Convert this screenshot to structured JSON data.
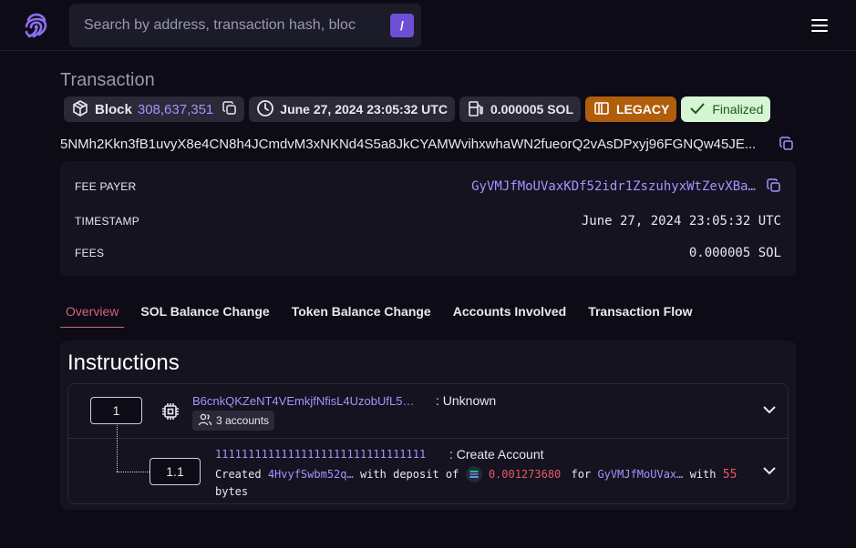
{
  "header": {
    "search_placeholder": "Search by address, transaction hash, bloc",
    "search_shortcut": "/",
    "logo_icon": "solana-fingerprint-logo",
    "menu_icon": "hamburger-menu-icon"
  },
  "page": {
    "title": "Transaction",
    "signature": "5NMh2Kkn3fB1uvyX8e4CN8h4JCmdvM3xNKNd4S5a8JkCYAMWvihxwhaWN2fueorQ2vAsDPxyj96FGNQw45JE..."
  },
  "badges": {
    "block_label": "Block",
    "block_number": "308,637,351",
    "timestamp": "June 27, 2024 23:05:32 UTC",
    "fee": "0.000005 SOL",
    "version": "LEGACY",
    "status": "Finalized"
  },
  "details": {
    "fee_payer_label": "FEE PAYER",
    "fee_payer": "GyVMJfMoUVaxKDf52idr1ZszuhyxWtZevXBa…",
    "timestamp_label": "TIMESTAMP",
    "timestamp": "June 27, 2024 23:05:32 UTC",
    "fees_label": "FEES",
    "fees": "0.000005 SOL"
  },
  "tabs": [
    {
      "label": "Overview",
      "active": true
    },
    {
      "label": "SOL Balance Change",
      "active": false
    },
    {
      "label": "Token Balance Change",
      "active": false
    },
    {
      "label": "Accounts Involved",
      "active": false
    },
    {
      "label": "Transaction Flow",
      "active": false
    }
  ],
  "instructions": {
    "title": "Instructions",
    "items": [
      {
        "index": "1",
        "program": "B6cnkQKZeNT4VEmkjfNfisL4UzobUfL5…",
        "type": ": Unknown",
        "accounts": "3 accounts"
      }
    ],
    "inner": {
      "index": "1.1",
      "program": "11111111111111111111111111111111",
      "type": ": Create Account",
      "desc_created": "Created",
      "desc_account": "4HvyfSwbm52q…",
      "desc_with_deposit": "with deposit of",
      "desc_amount": "0.001273680",
      "desc_for": "for",
      "desc_payer": "GyVMJfMoUVax…",
      "desc_with": "with",
      "desc_bytes_num": "55",
      "desc_bytes": "bytes"
    }
  },
  "colors": {
    "background": "#0c0b16",
    "accent": "#a792ff",
    "legacy": "#b05e0c",
    "finalized": "#d5f5d5",
    "active_tab": "#d9607a",
    "amount": "#e8566b"
  }
}
